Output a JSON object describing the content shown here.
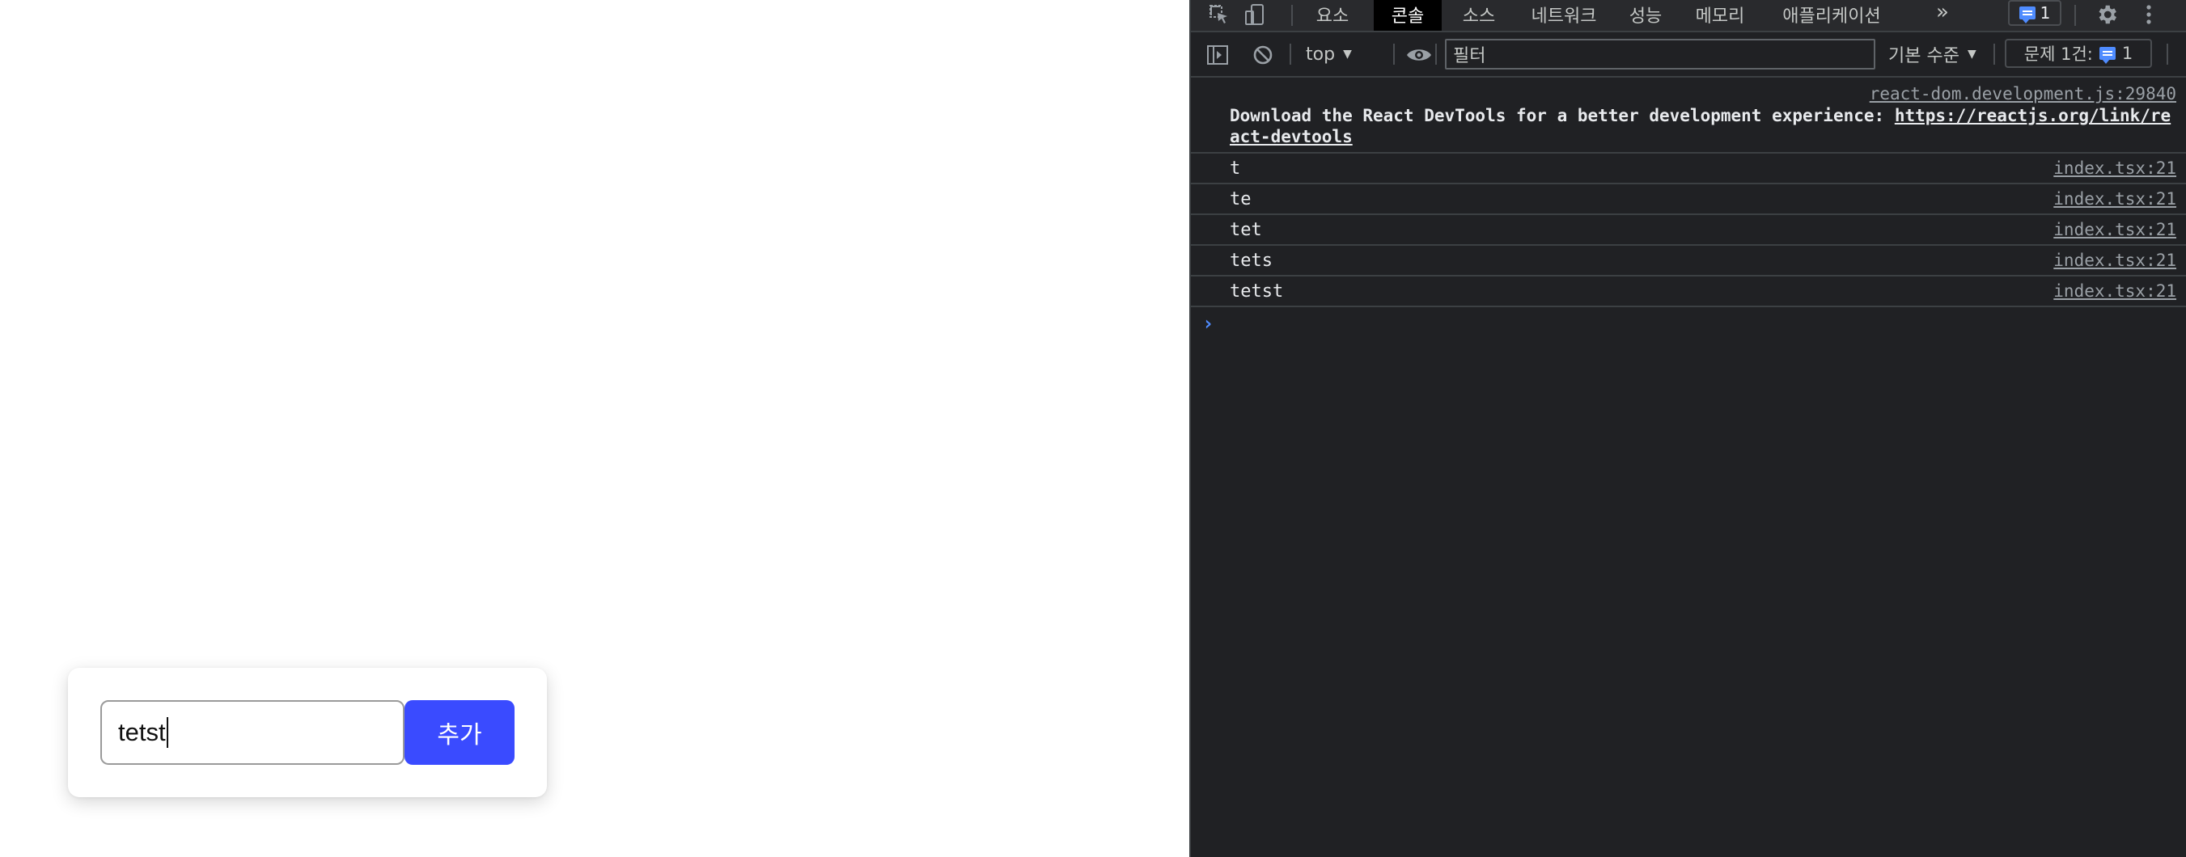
{
  "app": {
    "input_value": "tetst",
    "add_button_label": "추가",
    "accent_color": "#3a4bff"
  },
  "devtools": {
    "tabs": [
      "요소",
      "콘솔",
      "소스",
      "네트워크",
      "성능",
      "메모리",
      "애플리케이션"
    ],
    "active_tab": "콘솔",
    "more_tabs_glyph": "»",
    "issue_count": "1",
    "context_select": "top",
    "filter_placeholder": "필터",
    "level_select": "기본 수준",
    "issues_label": "문제 1건:",
    "issues_count": "1",
    "console": {
      "react_source": "react-dom.development.js:29840",
      "react_message": "Download the React DevTools for a better development experience: ",
      "react_link": "https://reactjs.org/link/react-devtools",
      "logs": [
        {
          "text": "t",
          "source": "index.tsx:21"
        },
        {
          "text": "te",
          "source": "index.tsx:21"
        },
        {
          "text": "tet",
          "source": "index.tsx:21"
        },
        {
          "text": "tets",
          "source": "index.tsx:21"
        },
        {
          "text": "tetst",
          "source": "index.tsx:21"
        }
      ],
      "prompt_glyph": "›"
    }
  }
}
